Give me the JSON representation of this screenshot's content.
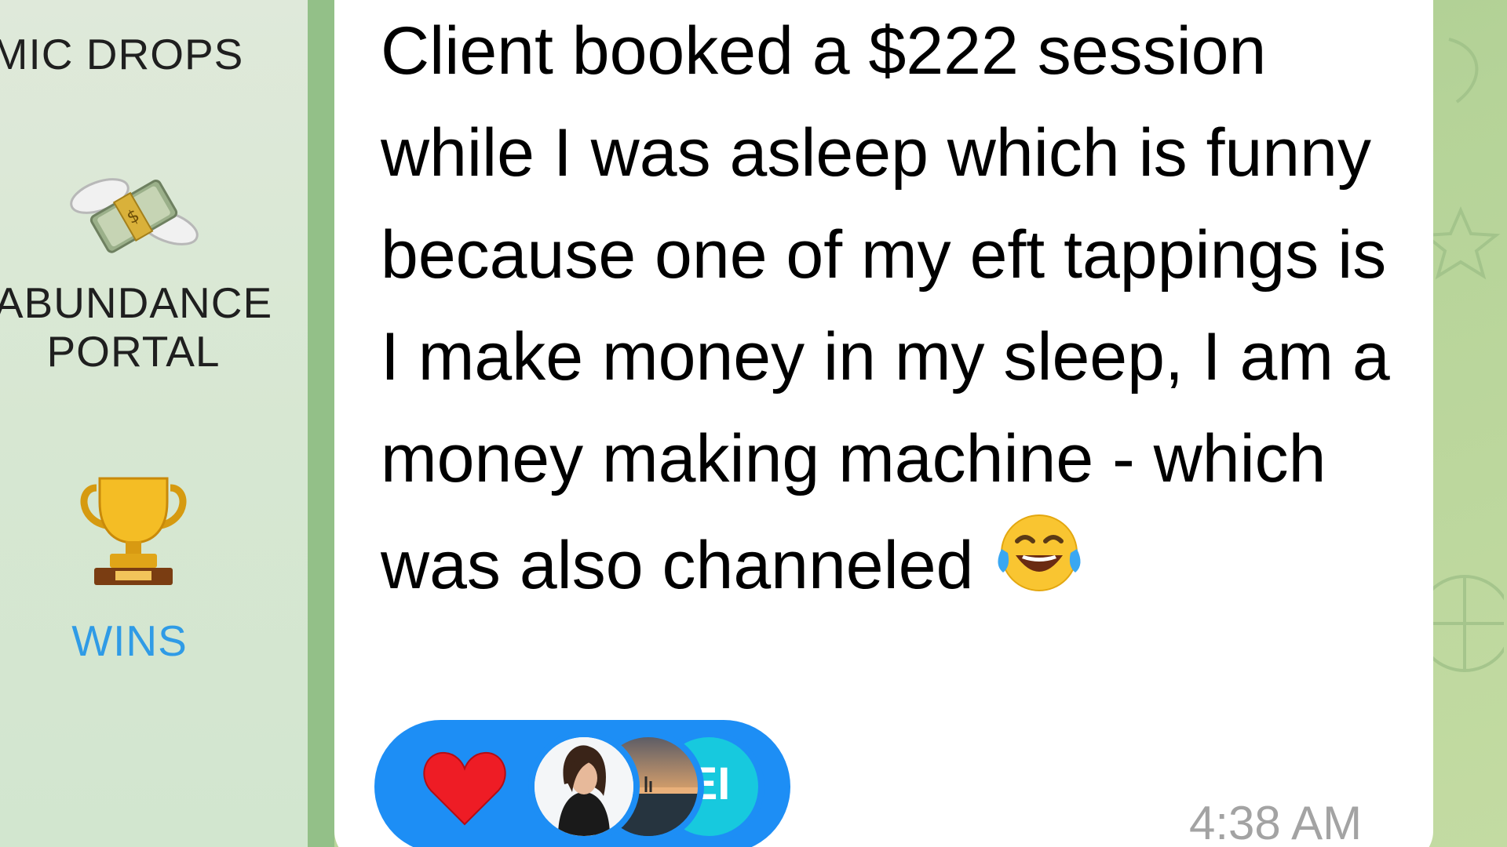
{
  "sidebar": {
    "folders": [
      {
        "label": "MIC DROPS",
        "icon": "microphone-icon",
        "active": false
      },
      {
        "label": "ABUNDANCE\nPORTAL",
        "icon": "money-with-wings-icon",
        "active": false
      },
      {
        "label": "WINS",
        "icon": "trophy-icon",
        "active": true
      }
    ]
  },
  "message": {
    "text": "Client booked a $222 session while I was asleep which is funny because one of my eft tappings is I make money in my sleep, I am a money making machine - which was also channeled",
    "emoji": "face-with-tears-of-joy-icon",
    "time": "4:38 AM",
    "reaction": {
      "emoji": "heart-icon",
      "avatars": [
        "avatar-woman-photo",
        "avatar-sunset-photo",
        "EI"
      ]
    }
  },
  "colors": {
    "accent": "#1d8ef5",
    "active_folder": "#2f9be6",
    "chat_background": "#b5d398",
    "sidebar_background": "#dfe9da",
    "timestamp": "#a3a3a3"
  }
}
